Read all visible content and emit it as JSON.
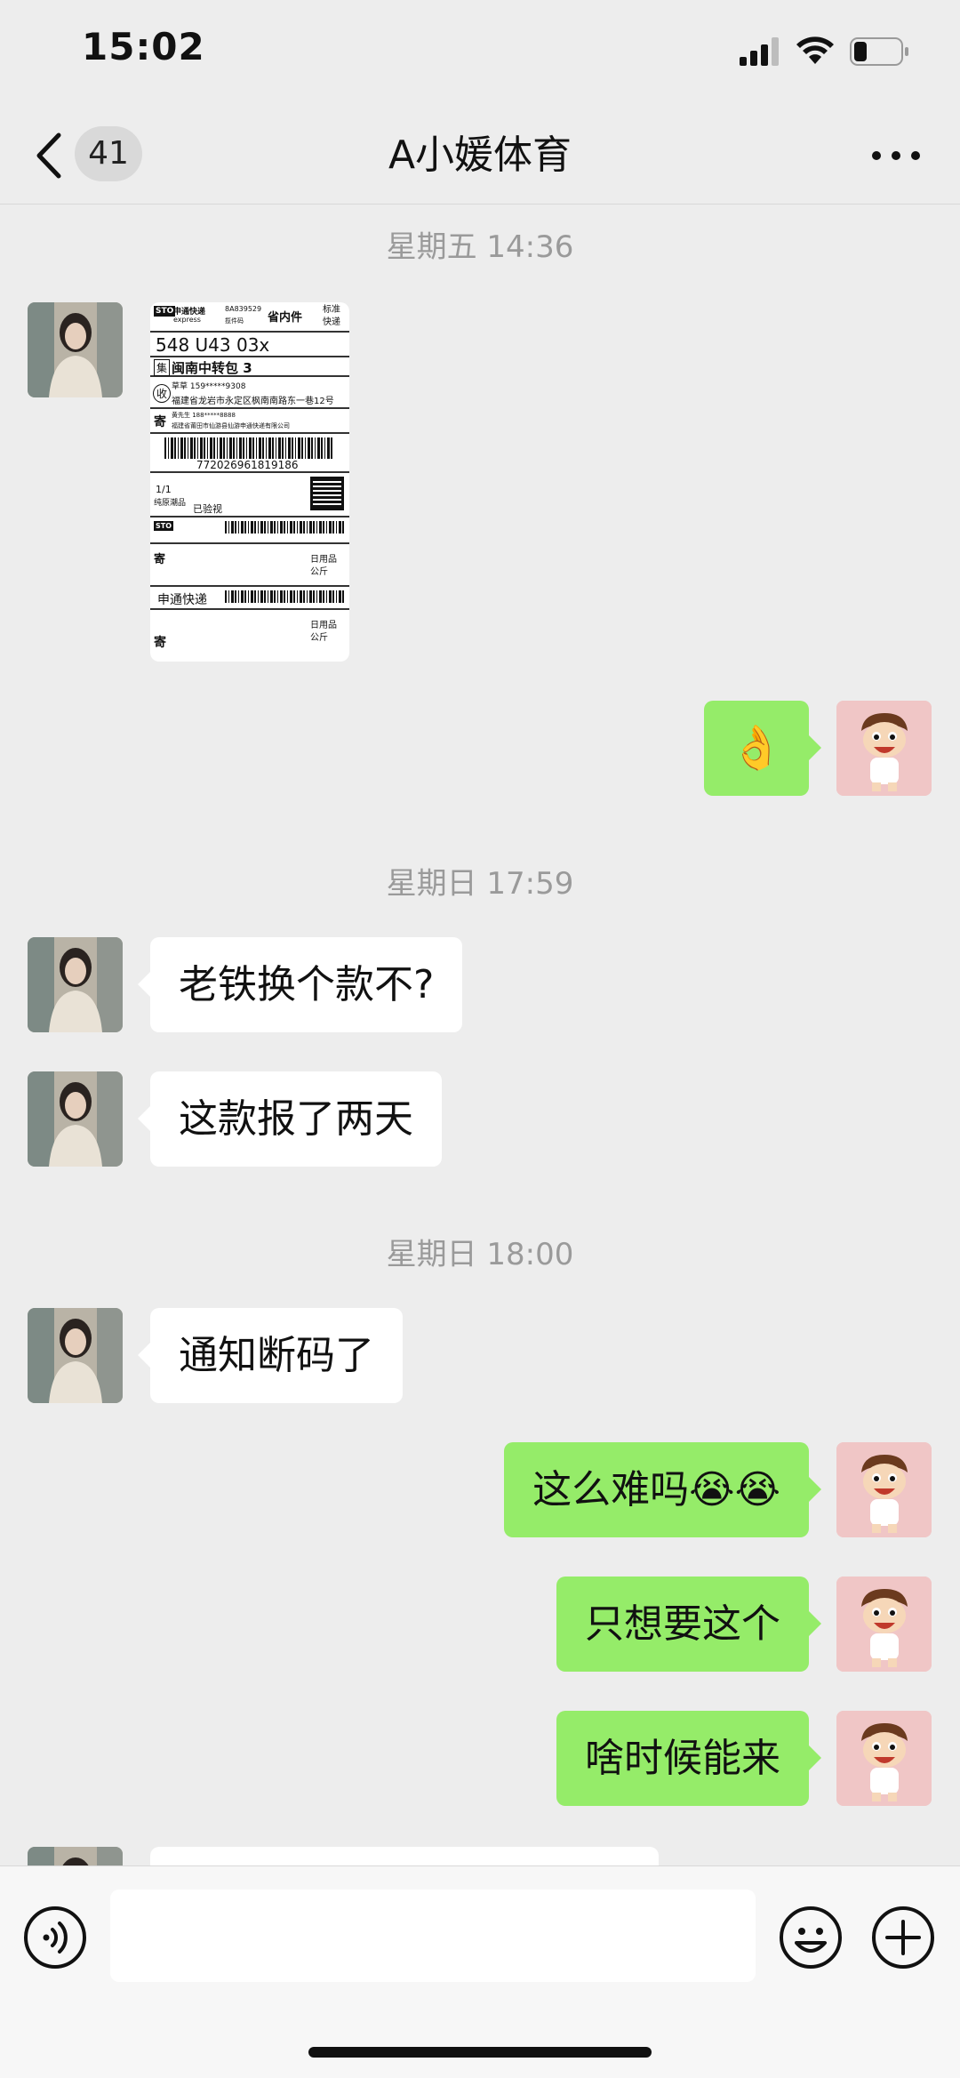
{
  "status_bar": {
    "time": "15:02"
  },
  "header": {
    "unread_count": "41",
    "title": "A小媛体育"
  },
  "label": {
    "brand": "申通快递",
    "brand_en": "express",
    "code1": "8A839529",
    "code1_sub": "揽件码",
    "type": "省内件",
    "service": "标准快递",
    "route": "548 U43 03x",
    "hub": "闽南中转包 3",
    "recipient_phone": "草草 159*****9308",
    "address": "福建省龙岩市永定区枫南南路东一巷12号",
    "sender": "黄先生 188*****8888",
    "sender_company": "福建省莆田市仙游县仙游申通快递有限公司",
    "tracking": "772026961819186",
    "qty": "1/1",
    "category": "纯原潮品",
    "inspected": "已验视",
    "brand2": "申通快递",
    "goods": "日用品",
    "goods2": "公斤",
    "ji": "寄",
    "shou": "收",
    "ji2": "寄",
    "ji3": "寄",
    "ji_shou": "集"
  },
  "messages": [
    {
      "type": "time",
      "text": "星期五 14:36"
    },
    {
      "type": "time",
      "text": "星期日 17:59"
    },
    {
      "type": "text",
      "side": "left",
      "text": "老铁换个款不?"
    },
    {
      "type": "text",
      "side": "left",
      "text": "这款报了两天"
    },
    {
      "type": "time",
      "text": "星期日 18:00"
    },
    {
      "type": "text",
      "side": "left",
      "text": "通知断码了"
    },
    {
      "type": "text",
      "side": "right",
      "text": "这么难吗😭😭"
    },
    {
      "type": "text",
      "side": "right",
      "text": "只想要这个"
    },
    {
      "type": "text",
      "side": "right",
      "text": "啥时候能来"
    }
  ],
  "sticker_emoji": "👌",
  "colors": {
    "bg": "#ededed",
    "bubble_right": "#95ec69",
    "bubble_left": "#ffffff",
    "time": "#9a9a9a"
  },
  "icons": [
    "chevron-left-icon",
    "more-icon",
    "voice-icon",
    "emoji-icon",
    "plus-icon",
    "signal-icon",
    "wifi-icon",
    "battery-icon"
  ]
}
